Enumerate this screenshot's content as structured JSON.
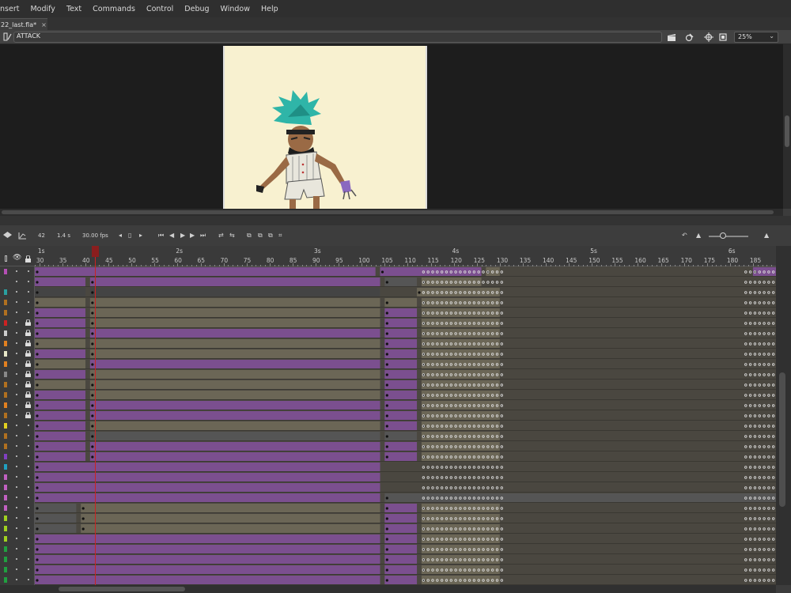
{
  "menu": [
    "nsert",
    "Modify",
    "Text",
    "Commands",
    "Control",
    "Debug",
    "Window",
    "Help"
  ],
  "document_tab": {
    "title": "22_last.fla*",
    "close": "×"
  },
  "editbar": {
    "scene_name": "ATTACK",
    "zoom": "25%"
  },
  "timeline": {
    "current_frame": "42",
    "elapsed": "1.4 s",
    "fps": "30.00 fps",
    "second_labels": [
      {
        "label": "1s",
        "frame": 30
      },
      {
        "label": "2s",
        "frame": 60
      },
      {
        "label": "3s",
        "frame": 90
      },
      {
        "label": "4s",
        "frame": 120
      },
      {
        "label": "5s",
        "frame": 150
      },
      {
        "label": "6s",
        "frame": 180
      }
    ],
    "frame_numbers": [
      30,
      35,
      40,
      45,
      50,
      55,
      60,
      65,
      70,
      75,
      80,
      85,
      90,
      95,
      100,
      105,
      110,
      115,
      120,
      125,
      130,
      135,
      140,
      145,
      150,
      155,
      160,
      165,
      170,
      175,
      180,
      185
    ],
    "playhead_frame": 42,
    "colors": {
      "purple_span": "#7b4f8f",
      "gray_span": "#6b6656",
      "empty": "#4a4740",
      "playhead": "#cc2222"
    },
    "layers": [
      {
        "color": "#b44fb4",
        "locked": false
      },
      {
        "color": "#3a3a3a",
        "locked": false
      },
      {
        "color": "#2aa0a0",
        "locked": false
      },
      {
        "color": "#b07020",
        "locked": false
      },
      {
        "color": "#b07020",
        "locked": false
      },
      {
        "color": "#cc2222",
        "locked": true
      },
      {
        "color": "#cccccc",
        "locked": true
      },
      {
        "color": "#e08020",
        "locked": true
      },
      {
        "color": "#e8e8c8",
        "locked": true
      },
      {
        "color": "#e08020",
        "locked": true
      },
      {
        "color": "#888888",
        "locked": true
      },
      {
        "color": "#b07020",
        "locked": true
      },
      {
        "color": "#b07020",
        "locked": true
      },
      {
        "color": "#e08020",
        "locked": true
      },
      {
        "color": "#b07020",
        "locked": true
      },
      {
        "color": "#e0d020",
        "locked": false
      },
      {
        "color": "#b07020",
        "locked": false
      },
      {
        "color": "#b07020",
        "locked": false
      },
      {
        "color": "#8040c0",
        "locked": false
      },
      {
        "color": "#20a0c0",
        "locked": false
      },
      {
        "color": "#c060c0",
        "locked": false
      },
      {
        "color": "#c060c0",
        "locked": false
      },
      {
        "color": "#c060c0",
        "locked": false
      },
      {
        "color": "#c060c0",
        "locked": false
      },
      {
        "color": "#a0d020",
        "locked": false
      },
      {
        "color": "#a0d020",
        "locked": false
      },
      {
        "color": "#a0d020",
        "locked": false
      },
      {
        "color": "#20a040",
        "locked": false
      },
      {
        "color": "#20a040",
        "locked": false
      },
      {
        "color": "#20a040",
        "locked": false
      },
      {
        "color": "#20a040",
        "locked": false
      }
    ]
  }
}
